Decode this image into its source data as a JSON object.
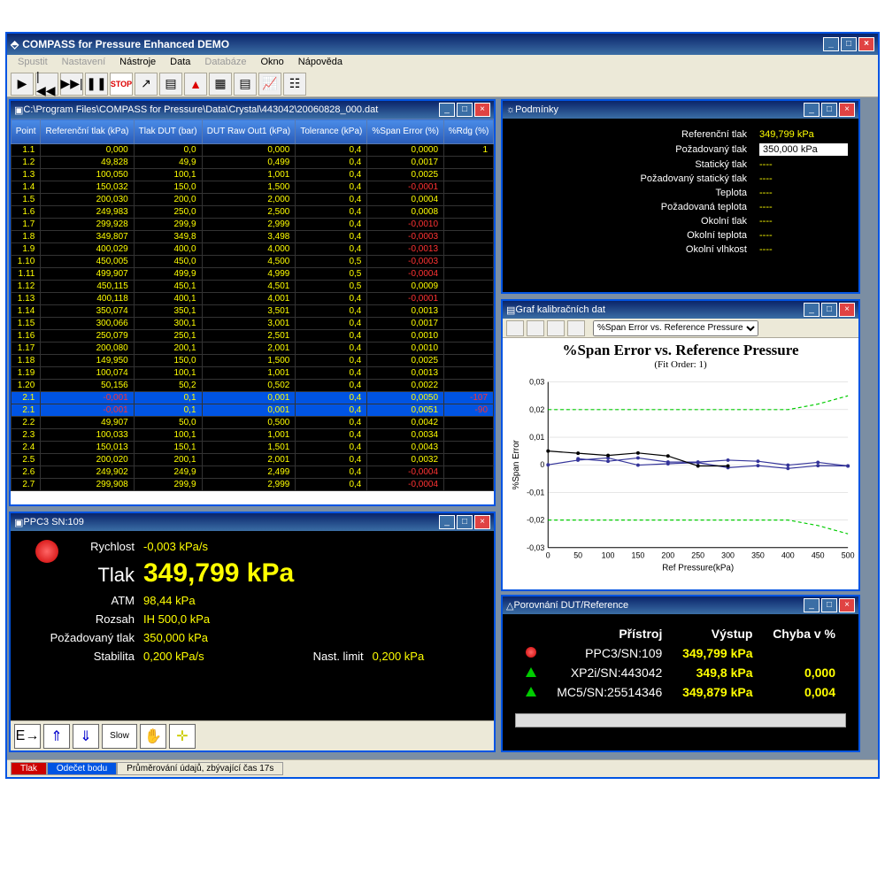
{
  "app": {
    "title": "COMPASS for Pressure Enhanced DEMO"
  },
  "menu": [
    "Spustit",
    "Nastavení",
    "Nástroje",
    "Data",
    "Databáze",
    "Okno",
    "Nápověda"
  ],
  "menu_disabled": [
    0,
    1,
    4
  ],
  "data_window": {
    "title": "C:\\Program Files\\COMPASS for Pressure\\Data\\Crystal\\443042\\20060828_000.dat",
    "columns": [
      "Point",
      "Referenční tlak (kPa)",
      "Tlak DUT (bar)",
      "DUT Raw Out1 (kPa)",
      "Tolerance (kPa)",
      "%Span Error (%)",
      "%Rdg (%)"
    ],
    "rows": [
      [
        "1.1",
        "0,000",
        "0,0",
        "0,000",
        "0,4",
        "0,0000",
        "1"
      ],
      [
        "1.2",
        "49,828",
        "49,9",
        "0,499",
        "0,4",
        "0,0017",
        ""
      ],
      [
        "1.3",
        "100,050",
        "100,1",
        "1,001",
        "0,4",
        "0,0025",
        ""
      ],
      [
        "1.4",
        "150,032",
        "150,0",
        "1,500",
        "0,4",
        "-0,0001",
        ""
      ],
      [
        "1.5",
        "200,030",
        "200,0",
        "2,000",
        "0,4",
        "0,0004",
        ""
      ],
      [
        "1.6",
        "249,983",
        "250,0",
        "2,500",
        "0,4",
        "0,0008",
        ""
      ],
      [
        "1.7",
        "299,928",
        "299,9",
        "2,999",
        "0,4",
        "-0,0010",
        ""
      ],
      [
        "1.8",
        "349,807",
        "349,8",
        "3,498",
        "0,4",
        "-0,0003",
        ""
      ],
      [
        "1.9",
        "400,029",
        "400,0",
        "4,000",
        "0,4",
        "-0,0013",
        ""
      ],
      [
        "1.10",
        "450,005",
        "450,0",
        "4,500",
        "0,5",
        "-0,0003",
        ""
      ],
      [
        "1.11",
        "499,907",
        "499,9",
        "4,999",
        "0,5",
        "-0,0004",
        ""
      ],
      [
        "1.12",
        "450,115",
        "450,1",
        "4,501",
        "0,5",
        "0,0009",
        ""
      ],
      [
        "1.13",
        "400,118",
        "400,1",
        "4,001",
        "0,4",
        "-0,0001",
        ""
      ],
      [
        "1.14",
        "350,074",
        "350,1",
        "3,501",
        "0,4",
        "0,0013",
        ""
      ],
      [
        "1.15",
        "300,066",
        "300,1",
        "3,001",
        "0,4",
        "0,0017",
        ""
      ],
      [
        "1.16",
        "250,079",
        "250,1",
        "2,501",
        "0,4",
        "0,0010",
        ""
      ],
      [
        "1.17",
        "200,080",
        "200,1",
        "2,001",
        "0,4",
        "0,0010",
        ""
      ],
      [
        "1.18",
        "149,950",
        "150,0",
        "1,500",
        "0,4",
        "0,0025",
        ""
      ],
      [
        "1.19",
        "100,074",
        "100,1",
        "1,001",
        "0,4",
        "0,0013",
        ""
      ],
      [
        "1.20",
        "50,156",
        "50,2",
        "0,502",
        "0,4",
        "0,0022",
        ""
      ],
      [
        "2.1",
        "-0,001",
        "0,1",
        "0,001",
        "0,4",
        "0,0050",
        "-107"
      ],
      [
        "2.1",
        "-0,001",
        "0,1",
        "0,001",
        "0,4",
        "0,0051",
        "-90"
      ],
      [
        "2.2",
        "49,907",
        "50,0",
        "0,500",
        "0,4",
        "0,0042",
        ""
      ],
      [
        "2.3",
        "100,033",
        "100,1",
        "1,001",
        "0,4",
        "0,0034",
        ""
      ],
      [
        "2.4",
        "150,013",
        "150,1",
        "1,501",
        "0,4",
        "0,0043",
        ""
      ],
      [
        "2.5",
        "200,020",
        "200,1",
        "2,001",
        "0,4",
        "0,0032",
        ""
      ],
      [
        "2.6",
        "249,902",
        "249,9",
        "2,499",
        "0,4",
        "-0,0004",
        ""
      ],
      [
        "2.7",
        "299,908",
        "299,9",
        "2,999",
        "0,4",
        "-0,0004",
        ""
      ]
    ]
  },
  "conditions": {
    "title": "Podmínky",
    "rows": [
      {
        "label": "Referenční tlak",
        "value": "349,799 kPa"
      },
      {
        "label": "Požadovaný tlak",
        "value": "350,000 kPa",
        "edit": true
      },
      {
        "label": "Statický tlak",
        "value": "----"
      },
      {
        "label": "Požadovaný statický tlak",
        "value": "----"
      },
      {
        "label": "Teplota",
        "value": "----"
      },
      {
        "label": "Požadovaná teplota",
        "value": "----"
      },
      {
        "label": "Okolní tlak",
        "value": "----"
      },
      {
        "label": "Okolní teplota",
        "value": "----"
      },
      {
        "label": "Okolní vlhkost",
        "value": "----"
      }
    ]
  },
  "graph": {
    "title": "Graf kalibračních dat",
    "select": "%Span Error vs. Reference Pressure",
    "chart_title": "%Span Error vs. Reference Pressure",
    "chart_sub": "(Fit Order: 1)",
    "ylabel": "%Span Error",
    "xlabel": "Ref Pressure(kPa)"
  },
  "chart_data": {
    "type": "line",
    "title": "%Span Error vs. Reference Pressure",
    "subtitle": "(Fit Order: 1)",
    "xlabel": "Ref Pressure(kPa)",
    "ylabel": "%Span Error",
    "xlim": [
      0,
      500
    ],
    "ylim": [
      -0.03,
      0.03
    ],
    "xticks": [
      0,
      50,
      100,
      150,
      200,
      250,
      300,
      350,
      400,
      450,
      500
    ],
    "yticks": [
      -0.03,
      -0.02,
      -0.01,
      0,
      0.01,
      0.02,
      0.03
    ],
    "series": [
      {
        "name": "tolerance_upper",
        "color": "#0c0",
        "dashed": true,
        "x": [
          0,
          50,
          100,
          150,
          200,
          250,
          300,
          350,
          400,
          450,
          500
        ],
        "y": [
          0.02,
          0.02,
          0.02,
          0.02,
          0.02,
          0.02,
          0.02,
          0.02,
          0.02,
          0.022,
          0.025
        ]
      },
      {
        "name": "tolerance_lower",
        "color": "#0c0",
        "dashed": true,
        "x": [
          0,
          50,
          100,
          150,
          200,
          250,
          300,
          350,
          400,
          450,
          500
        ],
        "y": [
          -0.02,
          -0.02,
          -0.02,
          -0.02,
          -0.02,
          -0.02,
          -0.02,
          -0.02,
          -0.02,
          -0.022,
          -0.025
        ]
      },
      {
        "name": "run1_up",
        "color": "#339",
        "x": [
          0,
          49.8,
          100,
          150,
          200,
          250,
          300,
          350,
          400,
          450,
          500
        ],
        "y": [
          0.0,
          0.0017,
          0.0025,
          -0.0001,
          0.0004,
          0.0008,
          -0.001,
          -0.0003,
          -0.0013,
          -0.0003,
          -0.0004
        ]
      },
      {
        "name": "run1_down",
        "color": "#339",
        "x": [
          500,
          450,
          400,
          350,
          300,
          250,
          200,
          150,
          100,
          50
        ],
        "y": [
          -0.0004,
          0.0009,
          -0.0001,
          0.0013,
          0.0017,
          0.001,
          0.001,
          0.0025,
          0.0013,
          0.0022
        ]
      },
      {
        "name": "run2",
        "color": "#000",
        "x": [
          0,
          50,
          100,
          150,
          200,
          250,
          300
        ],
        "y": [
          0.005,
          0.0042,
          0.0034,
          0.0043,
          0.0032,
          -0.0004,
          -0.0004
        ]
      }
    ]
  },
  "ppc": {
    "title": "PPC3 SN:109",
    "rows": {
      "rychlost_lbl": "Rychlost",
      "rychlost_val": "-0,003  kPa/s",
      "tlak_lbl": "Tlak",
      "tlak_val": "349,799  kPa",
      "atm_lbl": "ATM",
      "atm_val": "98,44 kPa",
      "rozsah_lbl": "Rozsah",
      "rozsah_val": "IH 500,0  kPa",
      "poz_lbl": "Požadovaný tlak",
      "poz_val": "350,000  kPa",
      "stab_lbl": "Stabilita",
      "stab_val": "0,200  kPa/s",
      "nast_lbl": "Nast. limit",
      "nast_val": "0,200  kPa"
    },
    "slow_btn": "Slow"
  },
  "comparison": {
    "title": "Porovnání DUT/Reference",
    "headers": [
      "Přístroj",
      "Výstup",
      "Chyba v %"
    ],
    "rows": [
      {
        "led": "red",
        "device": "PPC3/SN:109",
        "output": "349,799 kPa",
        "error": ""
      },
      {
        "led": "green",
        "device": "XP2i/SN:443042",
        "output": "349,8 kPa",
        "error": "0,000"
      },
      {
        "led": "green",
        "device": "MC5/SN:25514346",
        "output": "349,879 kPa",
        "error": "0,004"
      }
    ]
  },
  "status": {
    "tlak": "Tlak",
    "odecet": "Odečet bodu",
    "avg": "Průměrování údajů, zbývající čas 17s"
  }
}
